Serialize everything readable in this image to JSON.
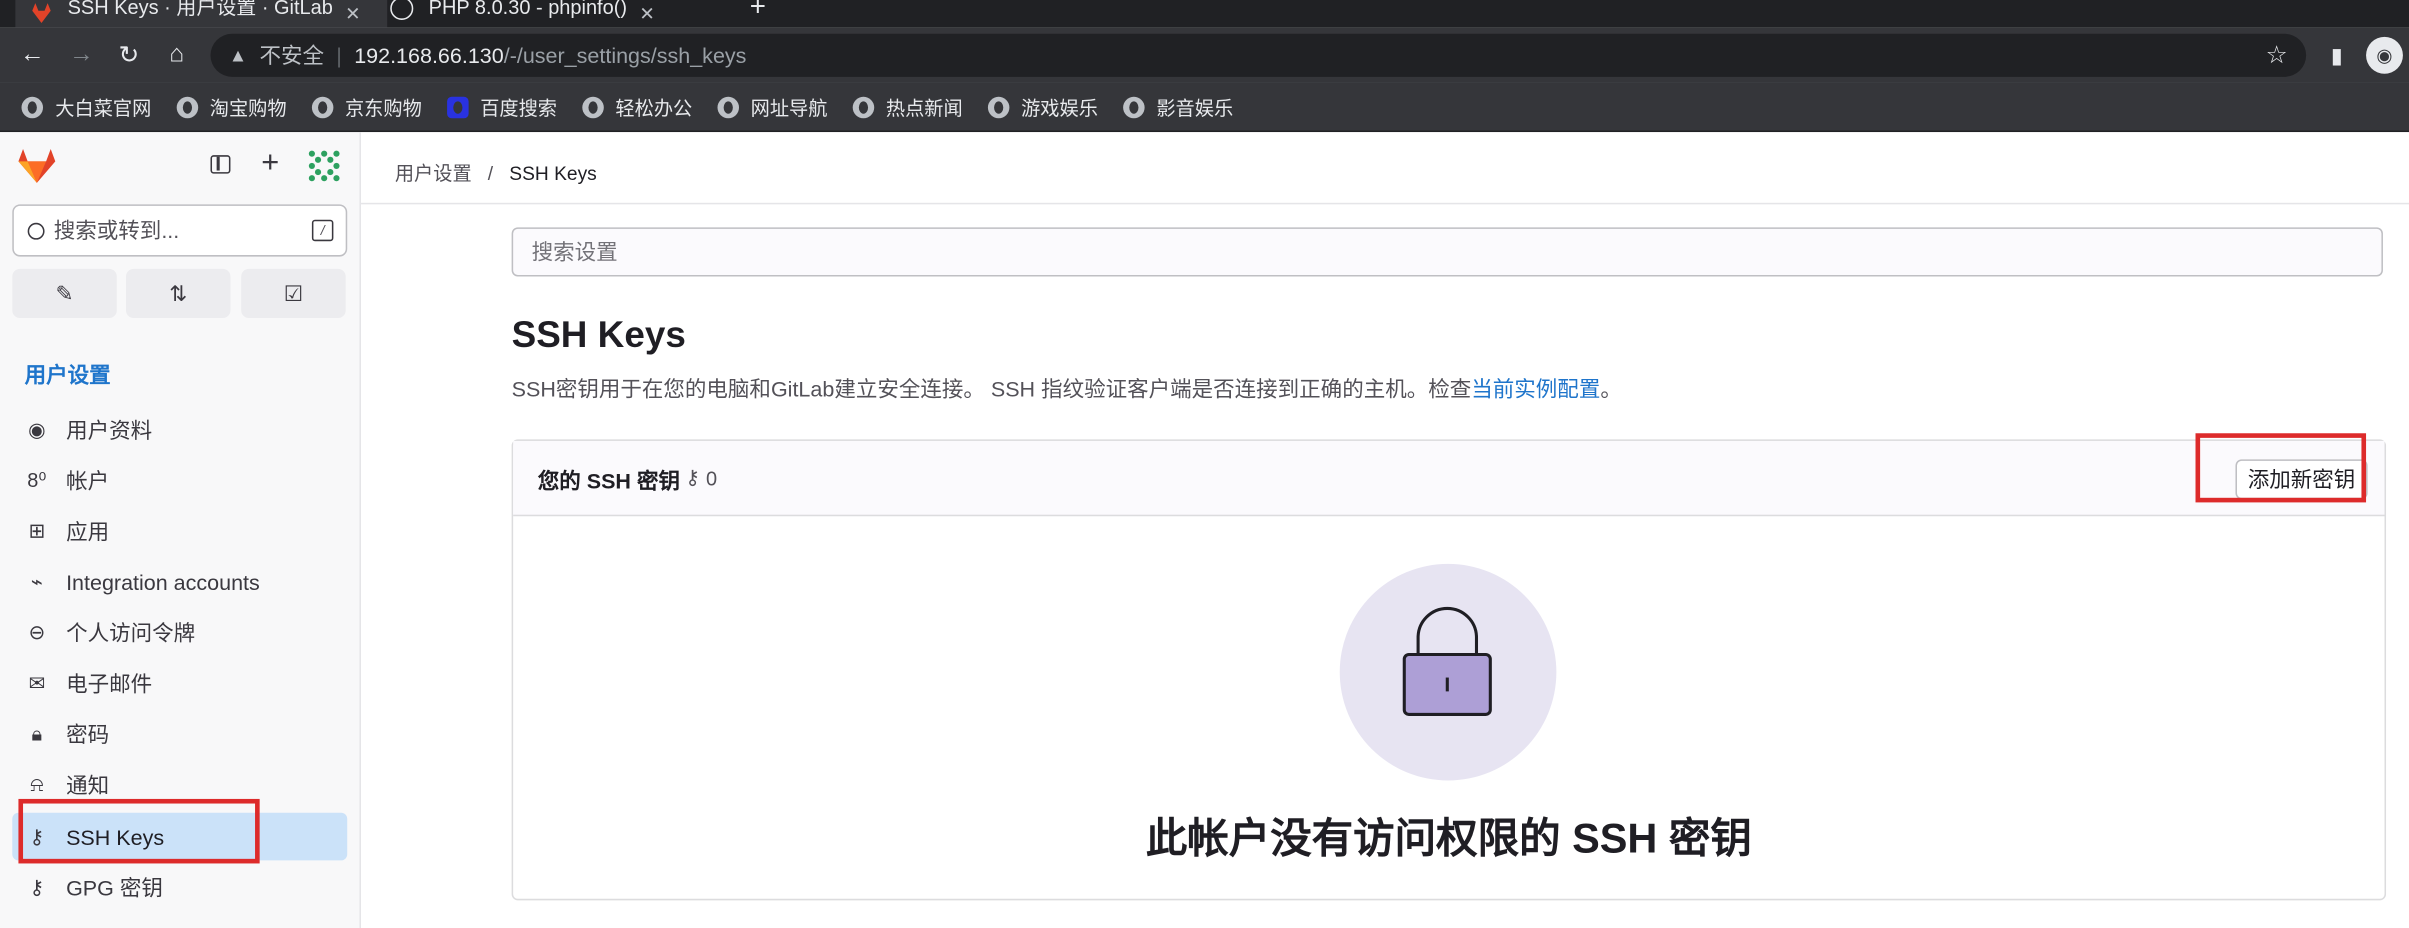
{
  "browser": {
    "tabs": [
      {
        "title": "SSH Keys · 用户设置 · GitLab",
        "active": true
      },
      {
        "title": "PHP 8.0.30 - phpinfo()",
        "active": false
      }
    ],
    "address": {
      "security": "不安全",
      "host": "192.168.66.130",
      "path": "/-/user_settings/ssh_keys"
    },
    "bookmarks": [
      "大白菜官网",
      "淘宝购物",
      "京东购物",
      "百度搜索",
      "轻松办公",
      "网址导航",
      "热点新闻",
      "游戏娱乐",
      "影音娱乐"
    ]
  },
  "sidebar": {
    "search_placeholder": "搜索或转到...",
    "search_shortcut": "/",
    "section_title": "用户设置",
    "items": [
      {
        "label": "用户资料",
        "icon": "profile-icon"
      },
      {
        "label": "帐户",
        "icon": "account-icon"
      },
      {
        "label": "应用",
        "icon": "applications-icon"
      },
      {
        "label": "Integration accounts",
        "icon": "integration-icon"
      },
      {
        "label": "个人访问令牌",
        "icon": "token-icon"
      },
      {
        "label": "电子邮件",
        "icon": "mail-icon"
      },
      {
        "label": "密码",
        "icon": "lock-icon"
      },
      {
        "label": "通知",
        "icon": "bell-icon"
      },
      {
        "label": "SSH Keys",
        "icon": "key-icon",
        "active": true
      },
      {
        "label": "GPG 密钥",
        "icon": "key-icon"
      }
    ]
  },
  "main": {
    "breadcrumb": [
      "用户设置",
      "SSH Keys"
    ],
    "settings_search_placeholder": "搜索设置",
    "title": "SSH Keys",
    "description": "SSH密钥用于在您的电脑和GitLab建立安全连接。 SSH 指纹验证客户端是否连接到正确的主机。检查",
    "description_link": "当前实例配置",
    "description_end": "。",
    "card": {
      "title": "您的 SSH 密钥",
      "key_count": "0",
      "add_button": "添加新密钥",
      "empty_title": "此帐户没有访问权限的 SSH 密钥"
    }
  },
  "colors": {
    "accent": "#1f75cb",
    "highlight": "#dd2b2b",
    "active_item": "#cbe2f9"
  }
}
